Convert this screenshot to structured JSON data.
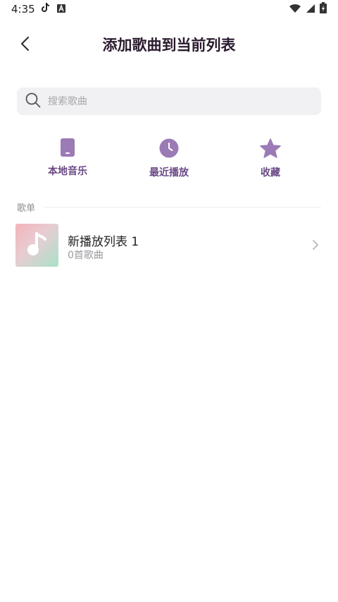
{
  "status_bar": {
    "time": "4:35",
    "notification_icons": [
      "tiktok-icon",
      "a-box-icon"
    ],
    "system_icons": [
      "wifi-icon",
      "cell-signal-icon",
      "battery-charging-icon"
    ]
  },
  "header": {
    "title": "添加歌曲到当前列表",
    "back_icon": "chevron-left-icon"
  },
  "search": {
    "placeholder": "搜索歌曲",
    "icon": "search-icon"
  },
  "quick_actions": [
    {
      "label": "本地音乐",
      "icon": "phone-icon"
    },
    {
      "label": "最近播放",
      "icon": "clock-icon"
    },
    {
      "label": "收藏",
      "icon": "star-icon"
    }
  ],
  "playlists_section": {
    "title": "歌单",
    "items": [
      {
        "name": "新播放列表 1",
        "count": "0首歌曲",
        "icon": "music-note-icon"
      }
    ]
  },
  "colors": {
    "accent": "#9b7bb5",
    "accent_text": "#6a4a85",
    "title": "#2a1b2e",
    "search_bg": "#f1f1f3"
  }
}
